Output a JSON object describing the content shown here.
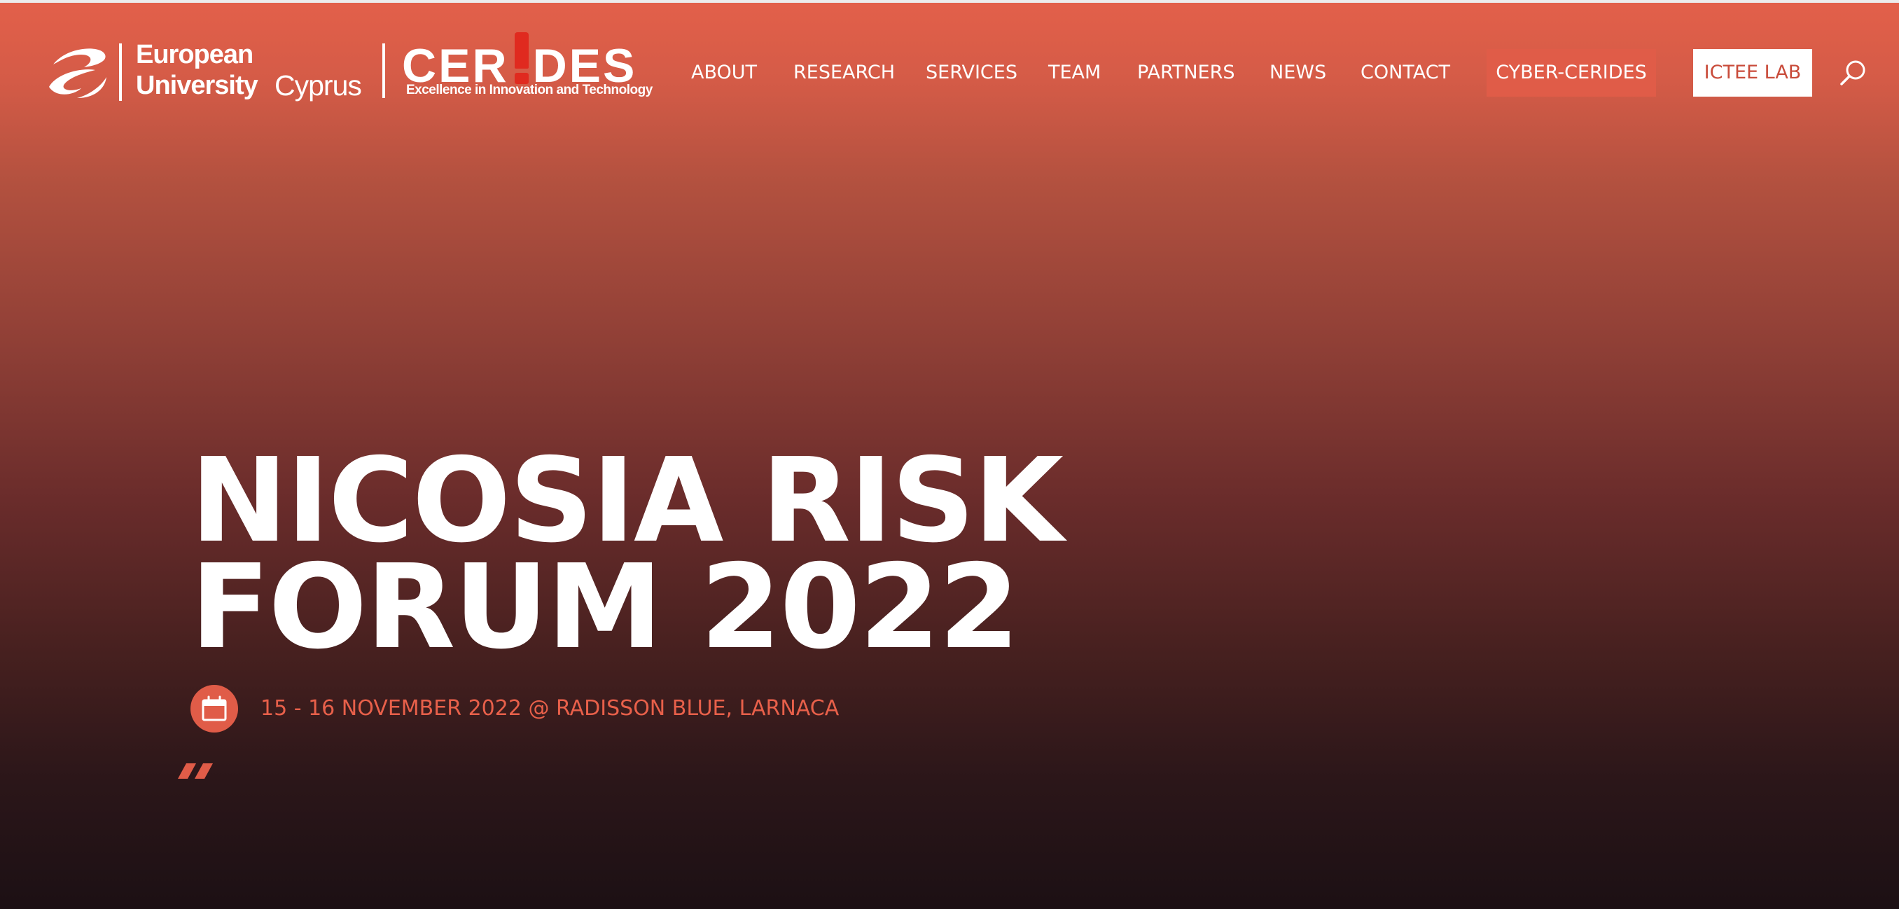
{
  "header": {
    "university_logo": {
      "line1": "European",
      "line2": "University",
      "line3": "Cyprus"
    },
    "cerides_logo": {
      "word_start": "CER",
      "word_end": "DES",
      "tagline": "Excellence in Innovation and Technology"
    },
    "nav": {
      "items": [
        {
          "label": "ABOUT"
        },
        {
          "label": "RESEARCH"
        },
        {
          "label": "SERVICES"
        },
        {
          "label": "TEAM"
        },
        {
          "label": "PARTNERS"
        },
        {
          "label": "NEWS"
        },
        {
          "label": "CONTACT"
        }
      ],
      "cyber_button": "CYBER-CERIDES",
      "ictee_button": "ICTEE LAB"
    },
    "search_icon": "search-icon"
  },
  "hero": {
    "title_line1": "NICOSIA RISK",
    "title_line2": "FORUM 2022",
    "event_date": "15 - 16 NOVEMBER 2022 @ RADISSON BLUE, LARNACA",
    "calendar_icon": "calendar-icon",
    "quote_icon": "quote-icon"
  },
  "colors": {
    "accent": "#e05c48",
    "accent_text": "#e8604a",
    "exclamation_red": "#e02a1f",
    "background_top": "#e3604a",
    "background_bottom": "#1c1014",
    "text": "#ffffff"
  }
}
